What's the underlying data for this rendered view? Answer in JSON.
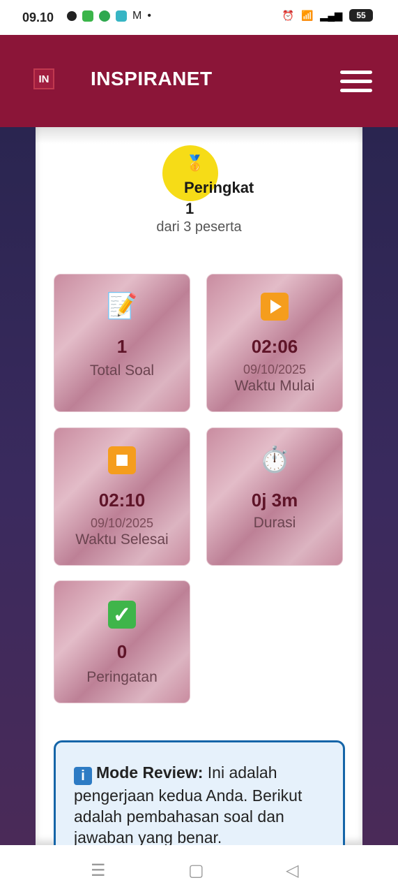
{
  "status_bar": {
    "time": "09.10",
    "battery": "55"
  },
  "header": {
    "logo_text": "IN",
    "brand": "INSPIRANET"
  },
  "rank": {
    "label": "Peringkat",
    "value": "1",
    "subtitle": "dari 3 peserta"
  },
  "stats": {
    "total_soal": {
      "value": "1",
      "label": "Total Soal",
      "icon": "memo-icon"
    },
    "waktu_mulai": {
      "value": "02:06",
      "date": "09/10/2025",
      "label": "Waktu Mulai",
      "icon": "play-icon"
    },
    "waktu_selesai": {
      "value": "02:10",
      "date": "09/10/2025",
      "label": "Waktu Selesai",
      "icon": "stop-icon"
    },
    "durasi": {
      "value": "0j 3m",
      "label": "Durasi",
      "icon": "stopwatch-icon"
    },
    "peringatan": {
      "value": "0",
      "label": "Peringatan",
      "icon": "check-icon"
    }
  },
  "review": {
    "title": "Mode Review:",
    "text": " Ini adalah pengerjaan kedua Anda. Berikut adalah pembahasan soal dan jawaban yang benar."
  },
  "colors": {
    "header": "#8b1538",
    "medal": "#f6dc17",
    "tile_value": "#5e1428",
    "review_border": "#1565a8"
  }
}
